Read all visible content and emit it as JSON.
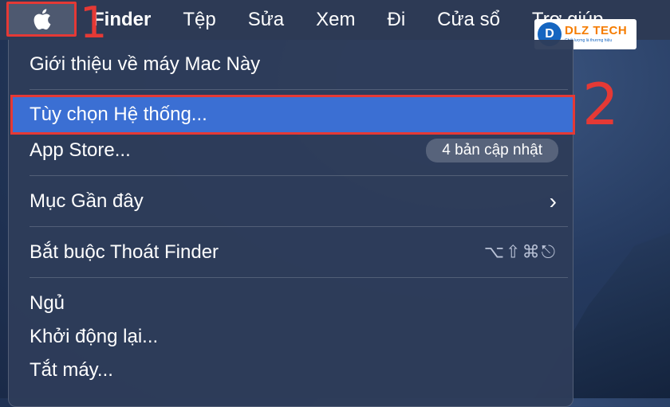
{
  "menubar": {
    "apple_icon": "apple-logo-icon",
    "items": [
      "Finder",
      "Tệp",
      "Sửa",
      "Xem",
      "Đi",
      "Cửa sổ",
      "Trợ giúp"
    ]
  },
  "markers": {
    "one": "1",
    "two": "2"
  },
  "logo": {
    "brand": "DLZ TECH",
    "mark": "D",
    "tagline": "Chất lượng là thương hiệu"
  },
  "menu": {
    "about": "Giới thiệu về máy Mac Này",
    "system_prefs": "Tùy chọn Hệ thống...",
    "app_store": "App Store...",
    "app_store_badge": "4 bản cập nhật",
    "recent_items": "Mục Gần đây",
    "force_quit": "Bắt buộc Thoát Finder",
    "force_quit_shortcut": "⌥⇧⌘⎋",
    "sleep": "Ngủ",
    "restart": "Khởi động lại...",
    "shutdown": "Tắt máy..."
  },
  "colors": {
    "highlight": "#3b6fd3",
    "annotation": "#e53935",
    "menubar": "#2d3a55"
  }
}
